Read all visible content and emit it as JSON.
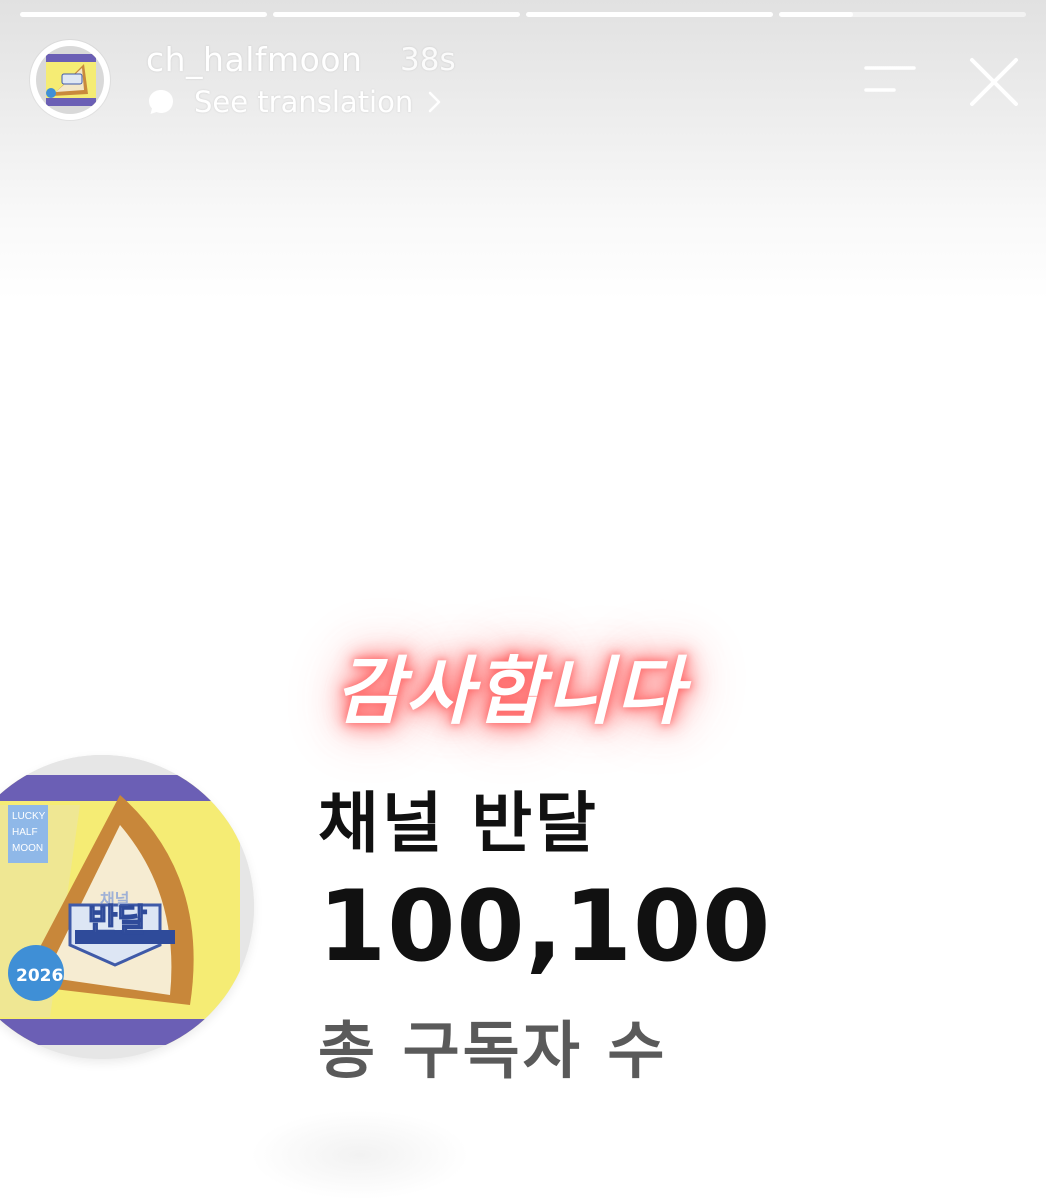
{
  "story": {
    "progress": [
      1,
      1,
      1,
      0.3
    ],
    "username": "ch_halfmoon",
    "time_ago": "38s",
    "see_translation": "See translation"
  },
  "content": {
    "thanks_text": "감사합니다",
    "channel_name": "채널 반달",
    "subscriber_count": "100,100",
    "subscriber_label": "총 구독자 수"
  },
  "product_image": {
    "lettering": [
      "LUCKY",
      "HALF",
      "MOON",
      "채널",
      "반달",
      "2026"
    ]
  },
  "colors": {
    "glow": "#ff4d4d",
    "text_primary": "#111111",
    "text_secondary": "#5a5a5a",
    "package_yellow": "#f5ec74",
    "package_purple": "#6b5fb5"
  },
  "icons": {
    "menu": "menu-lines-icon",
    "close": "close-icon",
    "translate": "chat-bubble-icon",
    "chevron": "chevron-right-icon"
  }
}
